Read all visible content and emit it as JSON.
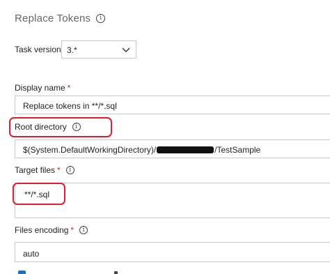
{
  "header": {
    "title": "Replace Tokens",
    "info_icon": "info-icon"
  },
  "task_version": {
    "label": "Task version",
    "value": "3.*",
    "icon": "chevron-down-icon"
  },
  "display_name": {
    "label": "Display name",
    "required_mark": "*",
    "value": "Replace tokens in **/*.sql"
  },
  "root_directory": {
    "label": "Root directory",
    "info_icon": "info-icon",
    "value_prefix": "$(System.DefaultWorkingDirectory)/",
    "value_suffix": "/TestSample"
  },
  "target_files": {
    "label": "Target files",
    "required_mark": "*",
    "info_icon": "info-icon",
    "value": "**/*.sql"
  },
  "files_encoding": {
    "label": "Files encoding",
    "required_mark": "*",
    "info_icon": "info-icon",
    "value": "auto"
  },
  "colors": {
    "required": "#c42b1c",
    "highlight": "#e21b2d",
    "checkbox": "#1f6fc5",
    "border": "#c8c8c8"
  }
}
